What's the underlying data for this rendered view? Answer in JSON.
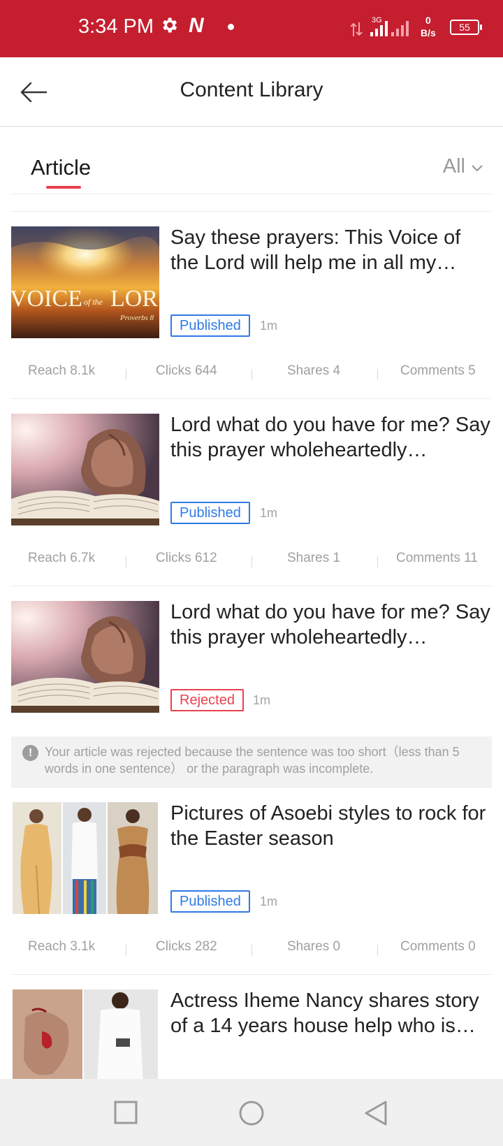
{
  "status_bar": {
    "time": "3:34 PM",
    "network_type": "3G",
    "speed_value": "0",
    "speed_unit": "B/s",
    "battery": "55"
  },
  "header": {
    "title": "Content Library"
  },
  "tabs": {
    "active_tab": "Article",
    "filter_label": "All"
  },
  "articles": [
    {
      "headline": "Say these prayers: This Voice of the Lord will help me in all my…",
      "status": "Published",
      "age": "1m",
      "stats": {
        "reach": "Reach 8.1k",
        "clicks": "Clicks 644",
        "shares": "Shares 4",
        "comments": "Comments 5"
      },
      "thumb_text_main": "VOICE",
      "thumb_text_small": "of the",
      "thumb_text_tail": "LOR",
      "thumb_caption": "Proverbs 8"
    },
    {
      "headline": "Lord what do you have for me? Say this prayer wholeheartedly…",
      "status": "Published",
      "age": "1m",
      "stats": {
        "reach": "Reach 6.7k",
        "clicks": "Clicks 612",
        "shares": "Shares 1",
        "comments": "Comments 11"
      }
    },
    {
      "headline": "Lord what do you have for me? Say this prayer wholeheartedly…",
      "status": "Rejected",
      "age": "1m",
      "rejection_message": "Your article was rejected because the sentence was too short（less than 5 words in one sentence） or the paragraph was incomplete."
    },
    {
      "headline": "Pictures of Asoebi styles to rock for the Easter season",
      "status": "Published",
      "age": "1m",
      "stats": {
        "reach": "Reach 3.1k",
        "clicks": "Clicks 282",
        "shares": "Shares 0",
        "comments": "Comments 0"
      }
    },
    {
      "headline": "Actress Iheme Nancy shares story of a 14 years house help who is…"
    }
  ],
  "colors": {
    "status_bar": "#c41e2f",
    "accent": "#e8414f",
    "published": "#2f7ae5",
    "rejected": "#e8414f"
  }
}
